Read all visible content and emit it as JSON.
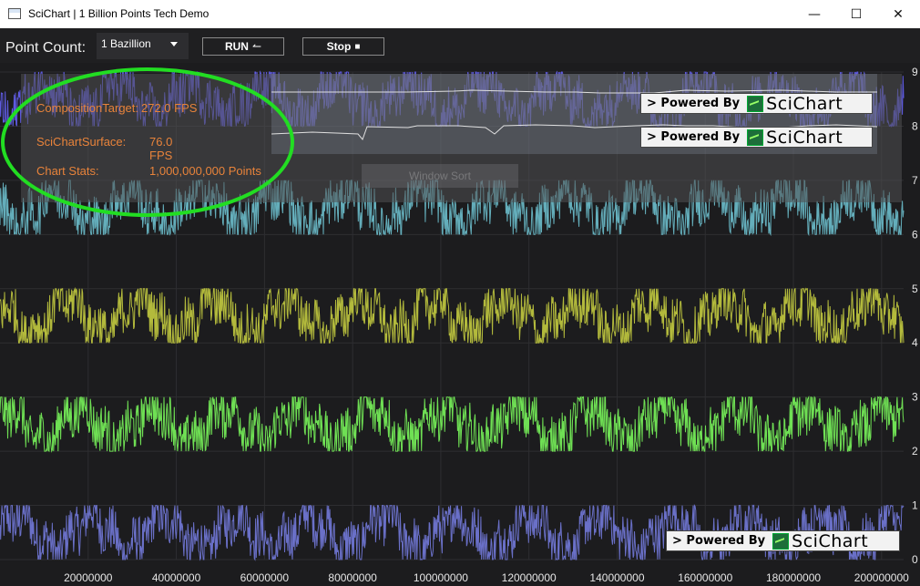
{
  "window": {
    "title": "SciChart | 1 Billion Points Tech Demo",
    "minimize_glyph": "—",
    "maximize_glyph": "☐",
    "close_glyph": "✕"
  },
  "toolbar": {
    "point_count_label": "Point Count:",
    "point_count_value": "1 Bazillion",
    "run_label": "RUN",
    "run_glyph": "↼",
    "stop_label": "Stop",
    "stop_glyph": "■"
  },
  "stats": {
    "composition_label": "CompositionTarget:",
    "composition_value": "272.0 FPS",
    "surface_label": "SciChartSurface:",
    "surface_value": "76.0 FPS",
    "chart_stats_label": "Chart Stats:",
    "chart_stats_value": "1,000,000,000 Points"
  },
  "watermarks": {
    "powered_by": "> Powered By",
    "brand": "SciChart"
  },
  "overlay_button_label": "Window Sort",
  "colors": {
    "band_0_1": "#6a70c8",
    "band_2_3": "#6fe054",
    "band_4_5": "#b3ba3c",
    "band_6_7": "#64aebb",
    "band_8_9": "#5e5ae0",
    "stats_text": "#e8833a",
    "highlight_ellipse": "#22dd22"
  },
  "chart_data": {
    "type": "line",
    "x_tick_labels": [
      "20000000",
      "40000000",
      "60000000",
      "80000000",
      "100000000",
      "120000000",
      "140000000",
      "160000000",
      "180000000",
      "200000000"
    ],
    "y_tick_labels": [
      "0",
      "1",
      "2",
      "3",
      "4",
      "5",
      "6",
      "7",
      "8",
      "9"
    ],
    "xlim": [
      0,
      205000000
    ],
    "ylim": [
      0,
      9
    ],
    "grid": true,
    "series": [
      {
        "band": [
          0,
          1
        ]
      },
      {
        "band": [
          2,
          3
        ]
      },
      {
        "band": [
          4,
          5
        ]
      },
      {
        "band": [
          6,
          7
        ]
      },
      {
        "band": [
          8,
          9
        ]
      }
    ]
  }
}
